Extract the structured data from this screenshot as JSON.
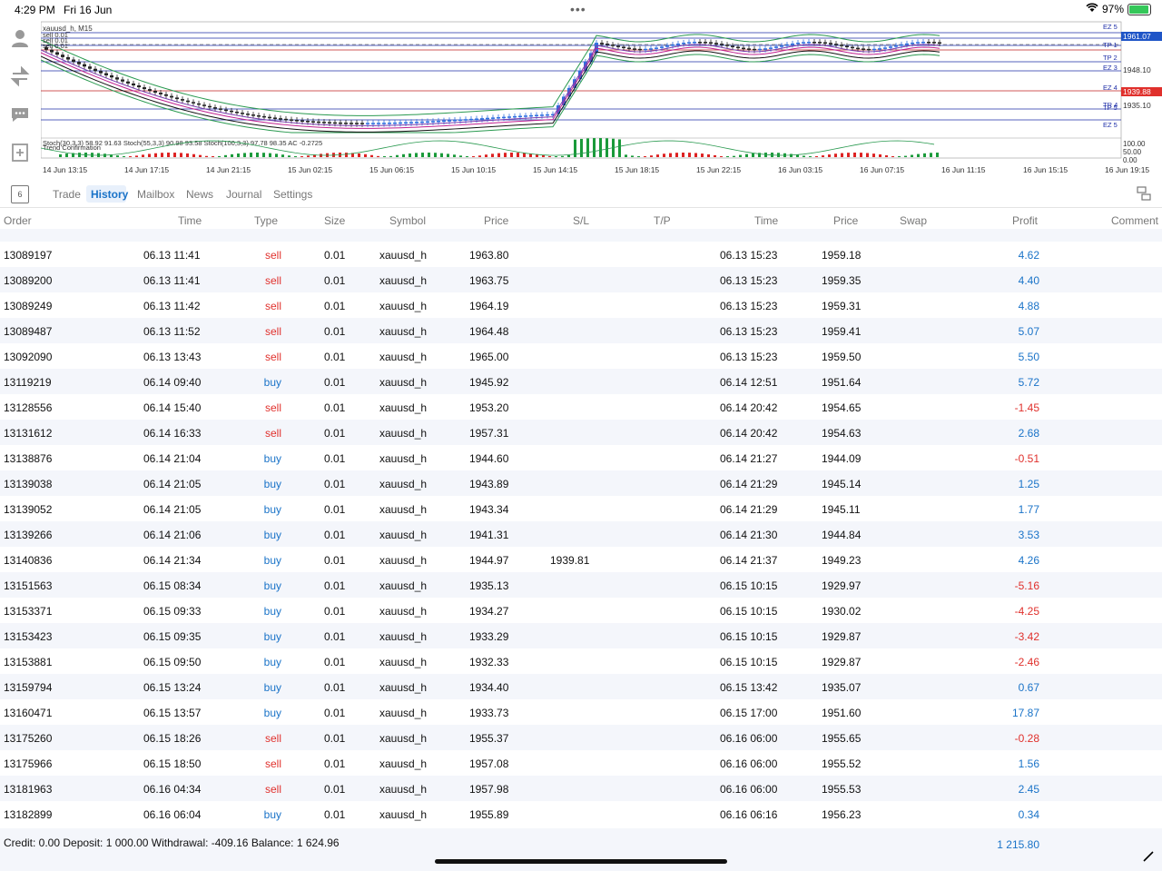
{
  "status": {
    "time": "4:29 PM",
    "date": "Fri 16 Jun",
    "battery": "97%",
    "battery_level": 0.97
  },
  "chart": {
    "symbol_label": "xauusd_h, M15",
    "orders": [
      "sell 0.01",
      "sell 0.01",
      "sell 0.01"
    ],
    "indicator_label": "Stoch(30,3,3) 58.92 91.63 Stoch(55,3,3) 90.98 93.58 Stoch(100,3,3) 97.78 98.35 AC -0.2725",
    "indicator_label2": "Trend Confirmation",
    "price_ticks": [
      "1961.07",
      "1948.10",
      "1939.88",
      "1935.10"
    ],
    "level_labels": [
      "EZ 5",
      "TP 2",
      "TP 1",
      "EZ 3",
      "EZ 4",
      "TR 4",
      "TP 5",
      "EZ 5"
    ],
    "osc_ticks": [
      "100.00",
      "50.00",
      "0.00"
    ],
    "time_ticks": [
      "14 Jun 13:15",
      "14 Jun 17:15",
      "14 Jun 21:15",
      "15 Jun 02:15",
      "15 Jun 06:15",
      "15 Jun 10:15",
      "15 Jun 14:15",
      "15 Jun 18:15",
      "15 Jun 22:15",
      "16 Jun 03:15",
      "16 Jun 07:15",
      "16 Jun 11:15",
      "16 Jun 15:15",
      "16 Jun 19:15"
    ],
    "colors": {
      "bid": "#1f55c7",
      "ask": "#e0302c",
      "bull": "#2f6fe0",
      "bear": "#222222"
    }
  },
  "tabs": {
    "calendar_day": "6",
    "trade": "Trade",
    "history": "History",
    "mailbox": "Mailbox",
    "news": "News",
    "journal": "Journal",
    "settings": "Settings"
  },
  "columns": {
    "order": "Order",
    "time": "Time",
    "type": "Type",
    "size": "Size",
    "symbol": "Symbol",
    "price": "Price",
    "sl": "S/L",
    "tp": "T/P",
    "time2": "Time",
    "price2": "Price",
    "swap": "Swap",
    "profit": "Profit",
    "comment": "Comment"
  },
  "rows": [
    {
      "order": "13089197",
      "time": "06.13 11:41",
      "type": "sell",
      "size": "0.01",
      "symbol": "xauusd_h",
      "price": "1963.80",
      "sl": "",
      "tp": "",
      "time2": "06.13 15:23",
      "price2": "1959.18",
      "swap": "",
      "profit": "4.62",
      "comment": ""
    },
    {
      "order": "13089200",
      "time": "06.13 11:41",
      "type": "sell",
      "size": "0.01",
      "symbol": "xauusd_h",
      "price": "1963.75",
      "sl": "",
      "tp": "",
      "time2": "06.13 15:23",
      "price2": "1959.35",
      "swap": "",
      "profit": "4.40",
      "comment": ""
    },
    {
      "order": "13089249",
      "time": "06.13 11:42",
      "type": "sell",
      "size": "0.01",
      "symbol": "xauusd_h",
      "price": "1964.19",
      "sl": "",
      "tp": "",
      "time2": "06.13 15:23",
      "price2": "1959.31",
      "swap": "",
      "profit": "4.88",
      "comment": ""
    },
    {
      "order": "13089487",
      "time": "06.13 11:52",
      "type": "sell",
      "size": "0.01",
      "symbol": "xauusd_h",
      "price": "1964.48",
      "sl": "",
      "tp": "",
      "time2": "06.13 15:23",
      "price2": "1959.41",
      "swap": "",
      "profit": "5.07",
      "comment": ""
    },
    {
      "order": "13092090",
      "time": "06.13 13:43",
      "type": "sell",
      "size": "0.01",
      "symbol": "xauusd_h",
      "price": "1965.00",
      "sl": "",
      "tp": "",
      "time2": "06.13 15:23",
      "price2": "1959.50",
      "swap": "",
      "profit": "5.50",
      "comment": ""
    },
    {
      "order": "13119219",
      "time": "06.14 09:40",
      "type": "buy",
      "size": "0.01",
      "symbol": "xauusd_h",
      "price": "1945.92",
      "sl": "",
      "tp": "",
      "time2": "06.14 12:51",
      "price2": "1951.64",
      "swap": "",
      "profit": "5.72",
      "comment": ""
    },
    {
      "order": "13128556",
      "time": "06.14 15:40",
      "type": "sell",
      "size": "0.01",
      "symbol": "xauusd_h",
      "price": "1953.20",
      "sl": "",
      "tp": "",
      "time2": "06.14 20:42",
      "price2": "1954.65",
      "swap": "",
      "profit": "-1.45",
      "comment": ""
    },
    {
      "order": "13131612",
      "time": "06.14 16:33",
      "type": "sell",
      "size": "0.01",
      "symbol": "xauusd_h",
      "price": "1957.31",
      "sl": "",
      "tp": "",
      "time2": "06.14 20:42",
      "price2": "1954.63",
      "swap": "",
      "profit": "2.68",
      "comment": ""
    },
    {
      "order": "13138876",
      "time": "06.14 21:04",
      "type": "buy",
      "size": "0.01",
      "symbol": "xauusd_h",
      "price": "1944.60",
      "sl": "",
      "tp": "",
      "time2": "06.14 21:27",
      "price2": "1944.09",
      "swap": "",
      "profit": "-0.51",
      "comment": ""
    },
    {
      "order": "13139038",
      "time": "06.14 21:05",
      "type": "buy",
      "size": "0.01",
      "symbol": "xauusd_h",
      "price": "1943.89",
      "sl": "",
      "tp": "",
      "time2": "06.14 21:29",
      "price2": "1945.14",
      "swap": "",
      "profit": "1.25",
      "comment": ""
    },
    {
      "order": "13139052",
      "time": "06.14 21:05",
      "type": "buy",
      "size": "0.01",
      "symbol": "xauusd_h",
      "price": "1943.34",
      "sl": "",
      "tp": "",
      "time2": "06.14 21:29",
      "price2": "1945.11",
      "swap": "",
      "profit": "1.77",
      "comment": ""
    },
    {
      "order": "13139266",
      "time": "06.14 21:06",
      "type": "buy",
      "size": "0.01",
      "symbol": "xauusd_h",
      "price": "1941.31",
      "sl": "",
      "tp": "",
      "time2": "06.14 21:30",
      "price2": "1944.84",
      "swap": "",
      "profit": "3.53",
      "comment": ""
    },
    {
      "order": "13140836",
      "time": "06.14 21:34",
      "type": "buy",
      "size": "0.01",
      "symbol": "xauusd_h",
      "price": "1944.97",
      "sl": "1939.81",
      "tp": "",
      "time2": "06.14 21:37",
      "price2": "1949.23",
      "swap": "",
      "profit": "4.26",
      "comment": ""
    },
    {
      "order": "13151563",
      "time": "06.15 08:34",
      "type": "buy",
      "size": "0.01",
      "symbol": "xauusd_h",
      "price": "1935.13",
      "sl": "",
      "tp": "",
      "time2": "06.15 10:15",
      "price2": "1929.97",
      "swap": "",
      "profit": "-5.16",
      "comment": ""
    },
    {
      "order": "13153371",
      "time": "06.15 09:33",
      "type": "buy",
      "size": "0.01",
      "symbol": "xauusd_h",
      "price": "1934.27",
      "sl": "",
      "tp": "",
      "time2": "06.15 10:15",
      "price2": "1930.02",
      "swap": "",
      "profit": "-4.25",
      "comment": ""
    },
    {
      "order": "13153423",
      "time": "06.15 09:35",
      "type": "buy",
      "size": "0.01",
      "symbol": "xauusd_h",
      "price": "1933.29",
      "sl": "",
      "tp": "",
      "time2": "06.15 10:15",
      "price2": "1929.87",
      "swap": "",
      "profit": "-3.42",
      "comment": ""
    },
    {
      "order": "13153881",
      "time": "06.15 09:50",
      "type": "buy",
      "size": "0.01",
      "symbol": "xauusd_h",
      "price": "1932.33",
      "sl": "",
      "tp": "",
      "time2": "06.15 10:15",
      "price2": "1929.87",
      "swap": "",
      "profit": "-2.46",
      "comment": ""
    },
    {
      "order": "13159794",
      "time": "06.15 13:24",
      "type": "buy",
      "size": "0.01",
      "symbol": "xauusd_h",
      "price": "1934.40",
      "sl": "",
      "tp": "",
      "time2": "06.15 13:42",
      "price2": "1935.07",
      "swap": "",
      "profit": "0.67",
      "comment": ""
    },
    {
      "order": "13160471",
      "time": "06.15 13:57",
      "type": "buy",
      "size": "0.01",
      "symbol": "xauusd_h",
      "price": "1933.73",
      "sl": "",
      "tp": "",
      "time2": "06.15 17:00",
      "price2": "1951.60",
      "swap": "",
      "profit": "17.87",
      "comment": ""
    },
    {
      "order": "13175260",
      "time": "06.15 18:26",
      "type": "sell",
      "size": "0.01",
      "symbol": "xauusd_h",
      "price": "1955.37",
      "sl": "",
      "tp": "",
      "time2": "06.16 06:00",
      "price2": "1955.65",
      "swap": "",
      "profit": "-0.28",
      "comment": ""
    },
    {
      "order": "13175966",
      "time": "06.15 18:50",
      "type": "sell",
      "size": "0.01",
      "symbol": "xauusd_h",
      "price": "1957.08",
      "sl": "",
      "tp": "",
      "time2": "06.16 06:00",
      "price2": "1955.52",
      "swap": "",
      "profit": "1.56",
      "comment": ""
    },
    {
      "order": "13181963",
      "time": "06.16 04:34",
      "type": "sell",
      "size": "0.01",
      "symbol": "xauusd_h",
      "price": "1957.98",
      "sl": "",
      "tp": "",
      "time2": "06.16 06:00",
      "price2": "1955.53",
      "swap": "",
      "profit": "2.45",
      "comment": ""
    },
    {
      "order": "13182899",
      "time": "06.16 06:04",
      "type": "buy",
      "size": "0.01",
      "symbol": "xauusd_h",
      "price": "1955.89",
      "sl": "",
      "tp": "",
      "time2": "06.16 06:16",
      "price2": "1956.23",
      "swap": "",
      "profit": "0.34",
      "comment": ""
    }
  ],
  "footer": {
    "summary": "Credit: 0.00 Deposit: 1 000.00 Withdrawal: -409.16 Balance: 1 624.96",
    "total": "1 215.80"
  }
}
